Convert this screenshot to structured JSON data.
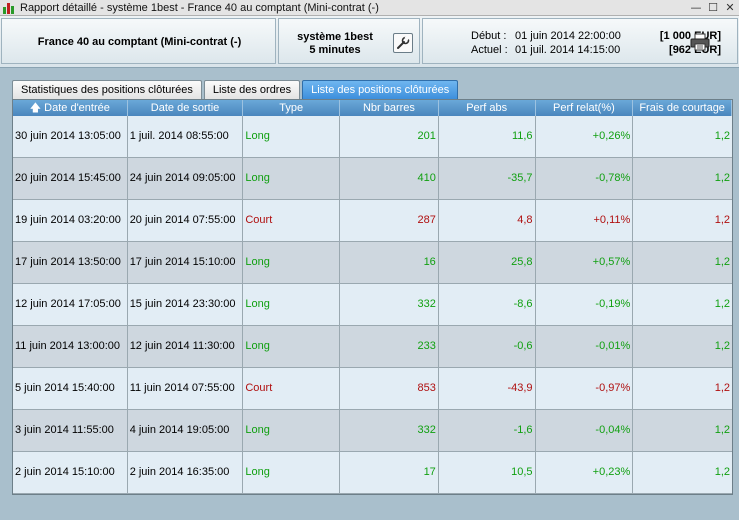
{
  "window": {
    "title": "Rapport détaillé - système 1best - France 40 au comptant (Mini-contrat  (-)"
  },
  "header": {
    "instrument": "France 40 au comptant (Mini-contrat  (-)",
    "system_line1": "système 1best",
    "system_line2": "5 minutes",
    "start_label": "Début :",
    "start_value": "01 juin 2014 22:00:00",
    "start_amount": "[1 000 EUR]",
    "current_label": "Actuel :",
    "current_value": "01 juil. 2014 14:15:00",
    "current_amount": "[962 EUR]"
  },
  "tabs": [
    {
      "label": "Statistiques des positions clôturées",
      "active": false
    },
    {
      "label": "Liste des ordres",
      "active": false
    },
    {
      "label": "Liste des positions clôturées",
      "active": true
    }
  ],
  "table": {
    "columns": [
      "Date d'entrée",
      "Date de sortie",
      "Type",
      "Nbr barres",
      "Perf abs",
      "Perf relat(%)",
      "Frais de courtage"
    ],
    "sort_indicator": "up-arrow-icon",
    "rows": [
      {
        "entry": "30 juin 2014 13:05:00",
        "exit": "1 juil. 2014 08:55:00",
        "type": "Long",
        "bars": "201",
        "perf_abs": "11,6",
        "perf_rel": "+0,26%",
        "fees": "1,2",
        "color": "green"
      },
      {
        "entry": "20 juin 2014 15:45:00",
        "exit": "24 juin 2014 09:05:00",
        "type": "Long",
        "bars": "410",
        "perf_abs": "-35,7",
        "perf_rel": "-0,78%",
        "fees": "1,2",
        "color": "green"
      },
      {
        "entry": "19 juin 2014 03:20:00",
        "exit": "20 juin 2014 07:55:00",
        "type": "Court",
        "bars": "287",
        "perf_abs": "4,8",
        "perf_rel": "+0,11%",
        "fees": "1,2",
        "color": "red"
      },
      {
        "entry": "17 juin 2014 13:50:00",
        "exit": "17 juin 2014 15:10:00",
        "type": "Long",
        "bars": "16",
        "perf_abs": "25,8",
        "perf_rel": "+0,57%",
        "fees": "1,2",
        "color": "green"
      },
      {
        "entry": "12 juin 2014 17:05:00",
        "exit": "15 juin 2014 23:30:00",
        "type": "Long",
        "bars": "332",
        "perf_abs": "-8,6",
        "perf_rel": "-0,19%",
        "fees": "1,2",
        "color": "green"
      },
      {
        "entry": "11 juin 2014 13:00:00",
        "exit": "12 juin 2014 11:30:00",
        "type": "Long",
        "bars": "233",
        "perf_abs": "-0,6",
        "perf_rel": "-0,01%",
        "fees": "1,2",
        "color": "green"
      },
      {
        "entry": "5 juin 2014 15:40:00",
        "exit": "11 juin 2014 07:55:00",
        "type": "Court",
        "bars": "853",
        "perf_abs": "-43,9",
        "perf_rel": "-0,97%",
        "fees": "1,2",
        "color": "red"
      },
      {
        "entry": "3 juin 2014 11:55:00",
        "exit": "4 juin 2014 19:05:00",
        "type": "Long",
        "bars": "332",
        "perf_abs": "-1,6",
        "perf_rel": "-0,04%",
        "fees": "1,2",
        "color": "green"
      },
      {
        "entry": "2 juin 2014 15:10:00",
        "exit": "2 juin 2014 16:35:00",
        "type": "Long",
        "bars": "17",
        "perf_abs": "10,5",
        "perf_rel": "+0,23%",
        "fees": "1,2",
        "color": "green"
      }
    ]
  },
  "colors": {
    "long": "#11a011",
    "short": "#b01010",
    "header_bg": "#4a86bd",
    "active_tab": "#3d8fdc"
  }
}
